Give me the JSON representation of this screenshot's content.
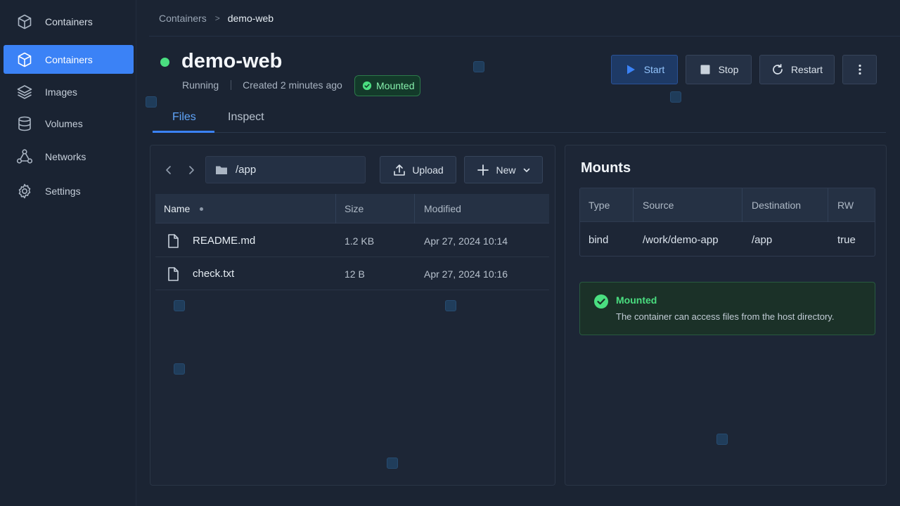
{
  "sidebar": {
    "brand": {
      "label": "Containers",
      "icon": "cube-icon"
    },
    "items": [
      {
        "label": "Containers",
        "icon": "cube-icon",
        "active": true
      },
      {
        "label": "Images",
        "icon": "layers-icon"
      },
      {
        "label": "Volumes",
        "icon": "database-icon"
      },
      {
        "label": "Networks",
        "icon": "network-icon"
      },
      {
        "label": "Settings",
        "icon": "gear-icon"
      }
    ]
  },
  "breadcrumb": {
    "parent": "Containers",
    "separator": ">",
    "current": "demo-web"
  },
  "header": {
    "title": "demo-web",
    "status": "Running",
    "created": "Created 2 minutes ago",
    "badge": "Mounted",
    "status_color": "#4ade80"
  },
  "actions": {
    "start": "Start",
    "stop": "Stop",
    "restart": "Restart"
  },
  "tabs": [
    {
      "label": "Files",
      "active": true
    },
    {
      "label": "Inspect"
    }
  ],
  "files": {
    "path": "/app",
    "upload_label": "Upload",
    "new_label": "New",
    "columns": {
      "name": "Name",
      "size": "Size",
      "modified": "Modified"
    },
    "rows": [
      {
        "name": "README.md",
        "size": "1.2 KB",
        "modified": "Apr 27, 2024 10:14"
      },
      {
        "name": "check.txt",
        "size": "12 B",
        "modified": "Apr 27, 2024 10:16"
      }
    ]
  },
  "mounts": {
    "title": "Mounts",
    "columns": {
      "type": "Type",
      "source": "Source",
      "destination": "Destination",
      "rw": "RW"
    },
    "rows": [
      {
        "type": "bind",
        "source": "/work/demo-app",
        "destination": "/app",
        "rw": "true"
      }
    ],
    "alert": {
      "title": "Mounted",
      "text": "The container can access files from the host directory."
    }
  },
  "colors": {
    "accent": "#3b82f6",
    "success": "#4ade80",
    "background": "#1b2433"
  }
}
